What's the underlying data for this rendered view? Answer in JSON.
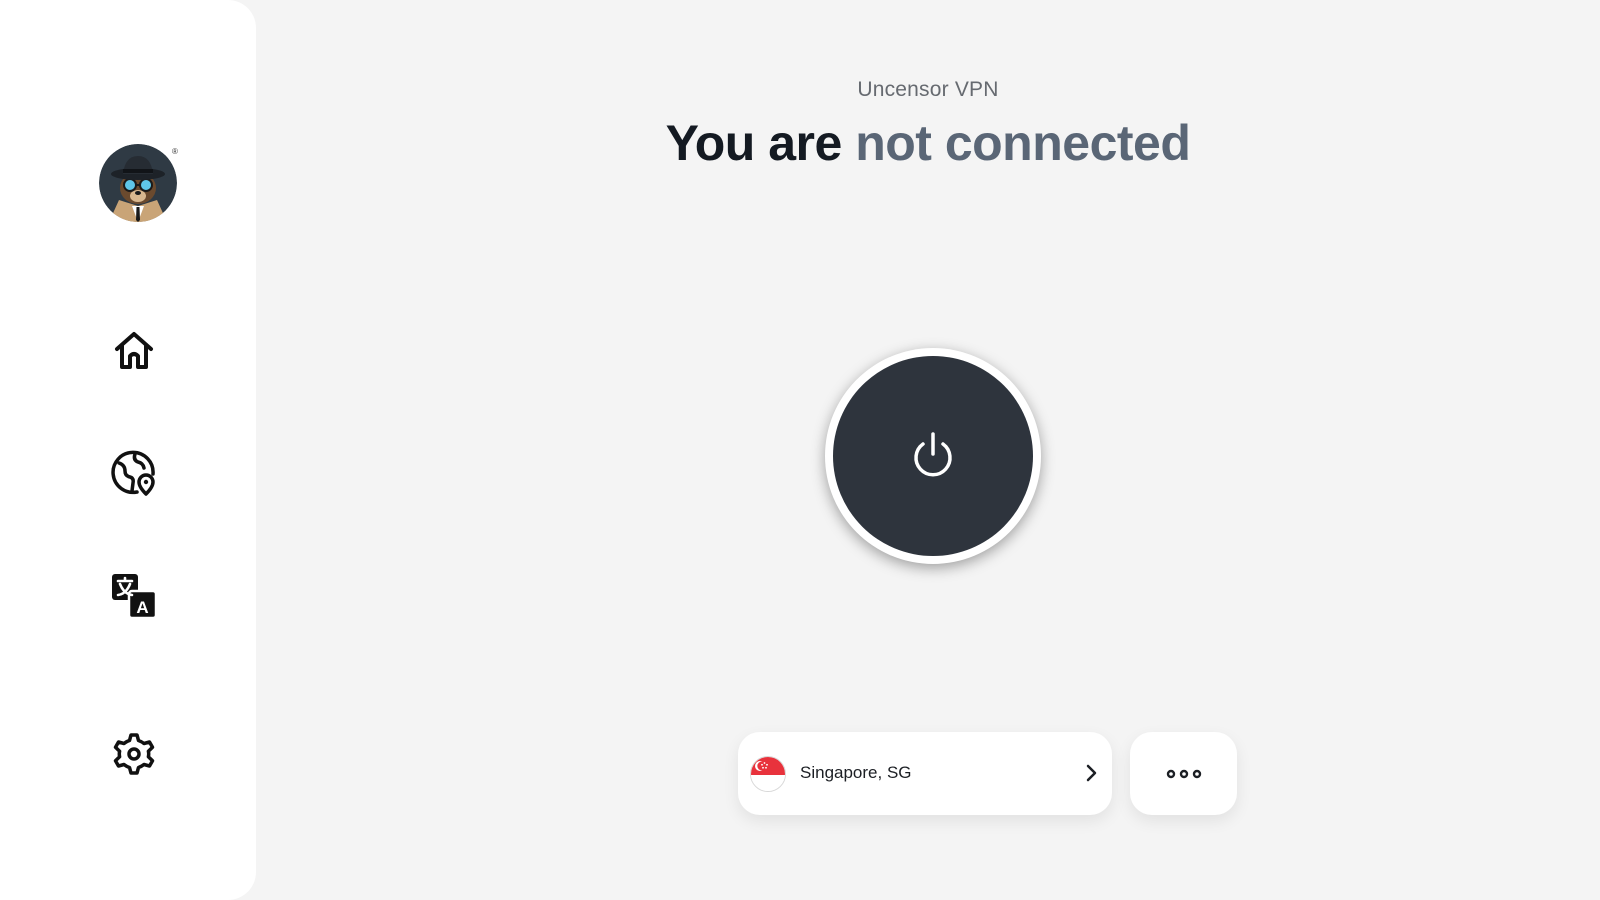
{
  "sidebar": {
    "avatar": {
      "icon": "spy-bear-avatar-icon",
      "mark": "®"
    },
    "nav": [
      {
        "id": "home",
        "icon": "home-icon"
      },
      {
        "id": "locations",
        "icon": "globe-location-icon"
      },
      {
        "id": "language",
        "icon": "translate-icon"
      },
      {
        "id": "settings",
        "icon": "gear-icon"
      }
    ]
  },
  "header": {
    "app_name": "Uncensor VPN",
    "headline_prefix": "You are ",
    "headline_status": "not connected"
  },
  "power": {
    "icon": "power-icon",
    "state": "disconnected"
  },
  "location": {
    "flag_icon": "singapore-flag-icon",
    "name": "Singapore, SG",
    "chevron_icon": "chevron-right-icon"
  },
  "more": {
    "icon": "more-horizontal-icon"
  },
  "colors": {
    "background": "#f4f4f4",
    "sidebar": "#ffffff",
    "headline": "#141a22",
    "status": "#5a6676",
    "power_button": "#2e343d"
  }
}
